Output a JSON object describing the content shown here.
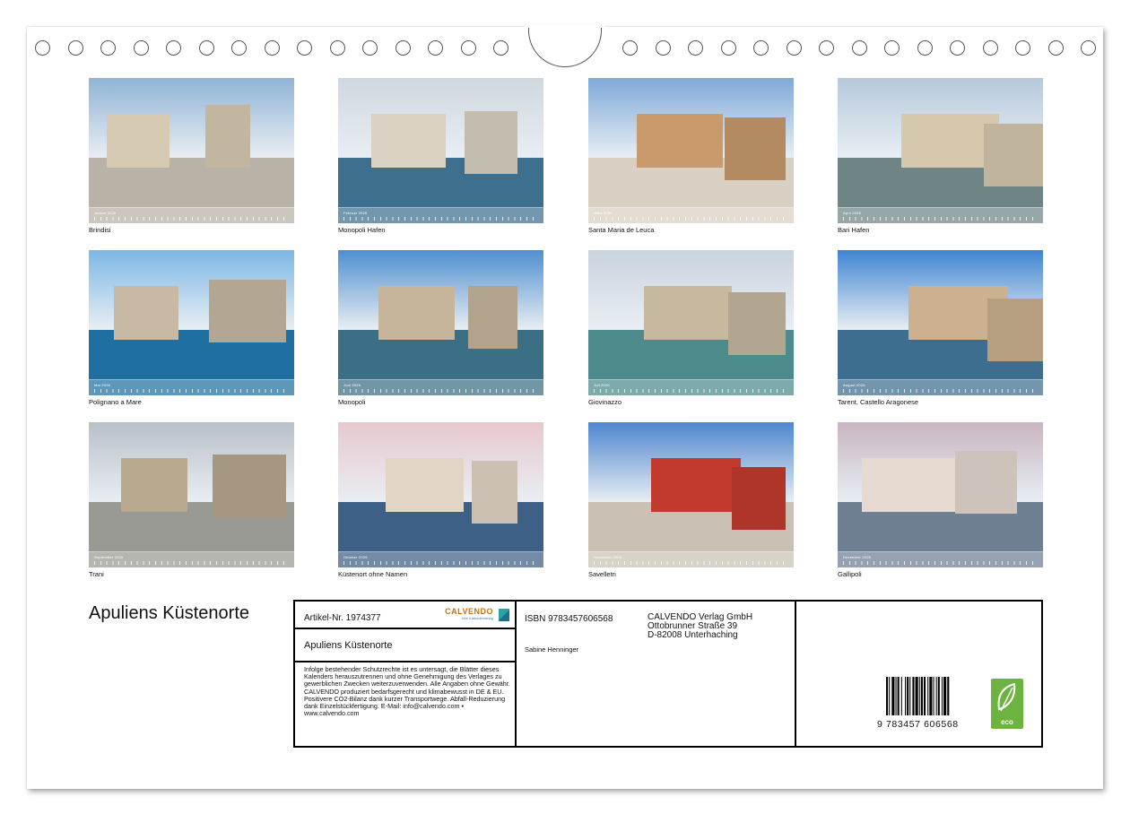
{
  "calendar": {
    "title": "Apuliens Küstenorte",
    "months": [
      {
        "name": "Januar 2026",
        "caption": "Brindisi",
        "sky": "#8fb3d6",
        "ground": "#b9b2a6",
        "accent": "#d7cab2"
      },
      {
        "name": "Februar 2026",
        "caption": "Monopoli Hafen",
        "sky": "#cfd8df",
        "ground": "#3d6f8f",
        "accent": "#d9d2c3"
      },
      {
        "name": "März 2026",
        "caption": "Santa Maria de Leuca",
        "sky": "#7fa9d8",
        "ground": "#d8d0c2",
        "accent": "#c89a6c"
      },
      {
        "name": "April 2026",
        "caption": "Bari Hafen",
        "sky": "#b6c9dc",
        "ground": "#6f8585",
        "accent": "#d6c8ad"
      },
      {
        "name": "Mai 2026",
        "caption": "Polignano a Mare",
        "sky": "#7db7e6",
        "ground": "#1f6fa0",
        "accent": "#c7b9a3"
      },
      {
        "name": "Juni 2026",
        "caption": "Monopoli",
        "sky": "#4f8fd0",
        "ground": "#3b6f86",
        "accent": "#c6b59b"
      },
      {
        "name": "Juli 2026",
        "caption": "Giovinazzo",
        "sky": "#c9d3de",
        "ground": "#4d8a8c",
        "accent": "#c7b8a0"
      },
      {
        "name": "August 2026",
        "caption": "Tarent, Castello Aragonese",
        "sky": "#3f85d1",
        "ground": "#3d6d8f",
        "accent": "#cbb190"
      },
      {
        "name": "September 2026",
        "caption": "Trani",
        "sky": "#b8c0c8",
        "ground": "#9a9a94",
        "accent": "#b8a98e"
      },
      {
        "name": "Oktober 2026",
        "caption": "Küstenort ohne Namen",
        "sky": "#e7c8cf",
        "ground": "#3e5f86",
        "accent": "#e3d5c6"
      },
      {
        "name": "November 2026",
        "caption": "Savelletri",
        "sky": "#4e86cf",
        "ground": "#c9c2b4",
        "accent": "#c23a2e"
      },
      {
        "name": "Dezember 2026",
        "caption": "Gallipoli",
        "sky": "#c8b5c0",
        "ground": "#6e7f94",
        "accent": "#e5d9d0"
      }
    ]
  },
  "infobox": {
    "article": "Artikel-Nr. 1974377",
    "logo_word": "CALVENDO",
    "logo_sub": "Ihre Kalenderverlag",
    "title": "Apuliens Küstenorte",
    "legal": "Infolge bestehender Schutzrechte ist es untersagt, die Blätter dieses Kalenders herauszutrennen und ohne Genehmigung des Verlages zu gewerblichen Zwecken weiterzuverwenden. Alle Angaben ohne Gewähr. CALVENDO produziert bedarfsgerecht und klimabewusst in DE & EU. Positivere CO2-Bilanz dank kurzer Transportwege. Abfall-Reduzierung dank Einzelstückfertigung. E-Mail: info@calvendo.com • www.calvendo.com",
    "isbn": "ISBN 9783457606568",
    "author": "Sabine Henninger",
    "publisher_name": "CALVENDO Verlag GmbH",
    "publisher_street": "Ottobrunner Straße 39",
    "publisher_city": "D-82008 Unterhaching",
    "barcode_digits": "9 783457 606568",
    "eco_label": "eco"
  }
}
